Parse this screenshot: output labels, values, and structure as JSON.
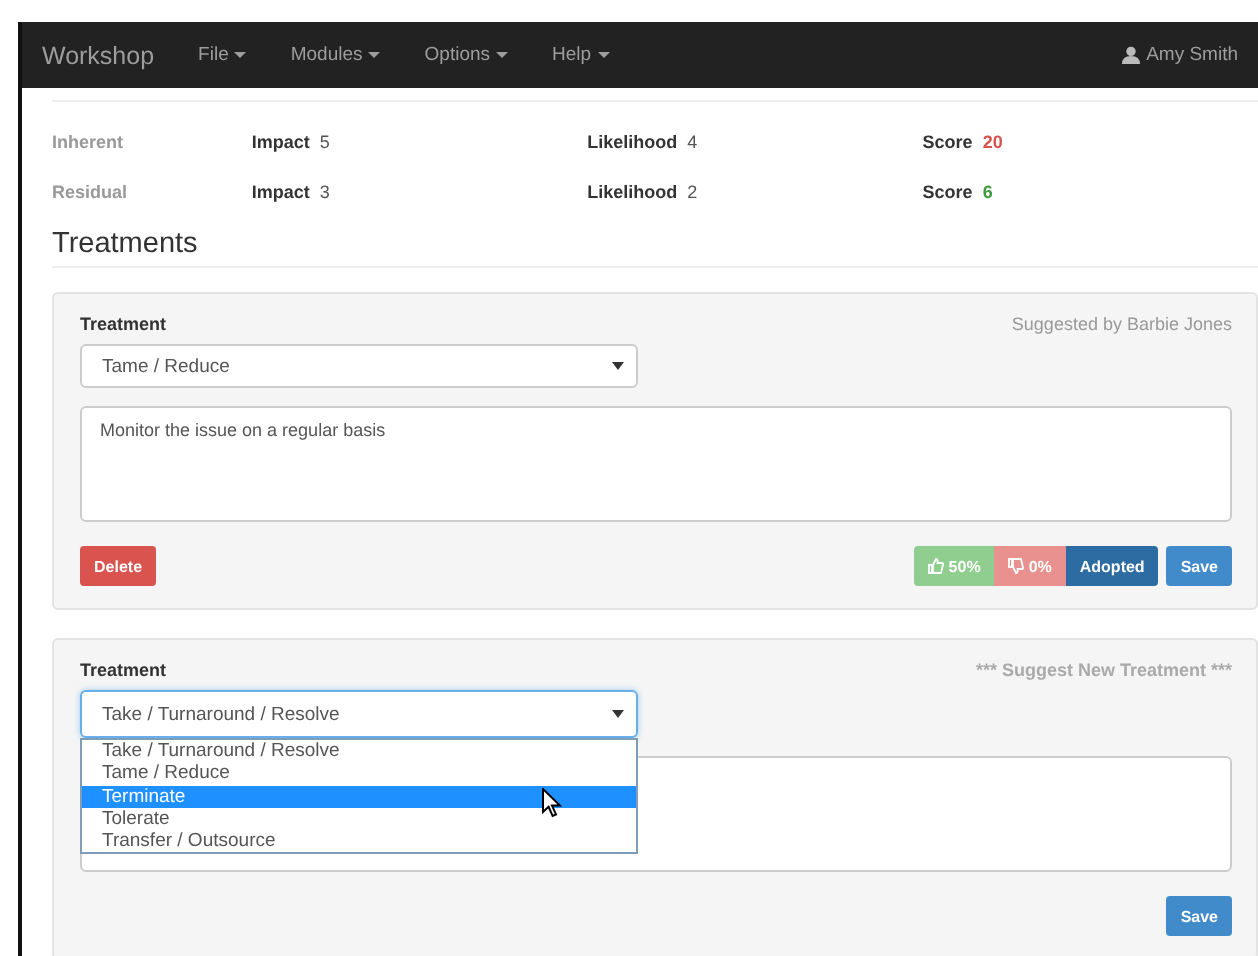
{
  "navbar": {
    "brand": "Workshop",
    "menus": [
      {
        "label": "File"
      },
      {
        "label": "Modules"
      },
      {
        "label": "Options"
      },
      {
        "label": "Help"
      }
    ],
    "user": "Amy Smith"
  },
  "scores": [
    {
      "label": "Inherent",
      "impact_label": "Impact",
      "impact": "5",
      "likelihood_label": "Likelihood",
      "likelihood": "4",
      "score_label": "Score",
      "score": "20",
      "color": "#d9534f"
    },
    {
      "label": "Residual",
      "impact_label": "Impact",
      "impact": "3",
      "likelihood_label": "Likelihood",
      "likelihood": "2",
      "score_label": "Score",
      "score": "6",
      "color": "#3c9a3c"
    }
  ],
  "treatments_heading": "Treatments",
  "treatments": [
    {
      "label": "Treatment",
      "note": "Suggested by Barbie Jones",
      "note_bold": false,
      "select": "Tame / Reduce",
      "dropdown_open": false,
      "text": "Monitor the issue on a regular basis",
      "buttons": [
        {
          "kind": "delete",
          "label": "Delete"
        },
        {
          "kind": "up",
          "label": "50%"
        },
        {
          "kind": "down",
          "label": "0%"
        },
        {
          "kind": "adopted",
          "label": "Adopted"
        },
        {
          "kind": "save",
          "label": "Save"
        }
      ]
    },
    {
      "label": "Treatment",
      "note": "*** Suggest New Treatment ***",
      "note_bold": true,
      "select": "Take / Turnaround / Resolve",
      "dropdown_open": true,
      "options": [
        {
          "label": "Take / Turnaround / Resolve",
          "selected": false
        },
        {
          "label": "Tame / Reduce",
          "selected": false
        },
        {
          "label": "Terminate",
          "selected": true
        },
        {
          "label": "Tolerate",
          "selected": false
        },
        {
          "label": "Transfer / Outsource",
          "selected": false
        }
      ],
      "buttons": [
        {
          "kind": "save",
          "label": "Save"
        }
      ]
    }
  ]
}
